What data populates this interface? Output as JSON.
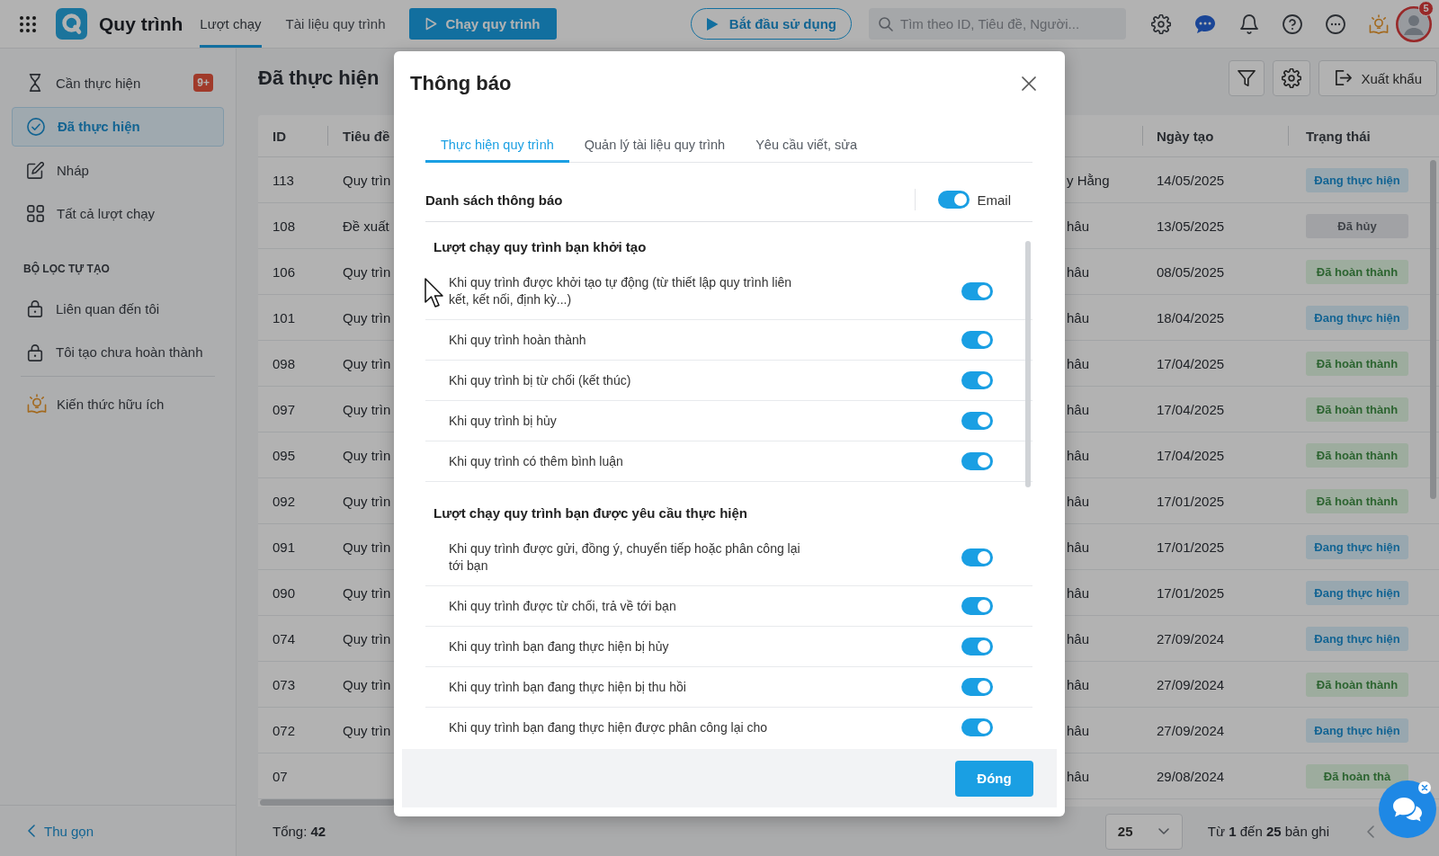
{
  "topbar": {
    "app_name": "Quy trình",
    "nav": [
      {
        "label": "Lượt chạy",
        "selected": true
      },
      {
        "label": "Tài liệu quy trình",
        "selected": false
      }
    ],
    "run_button": "Chạy quy trình",
    "start_button": "Bắt đầu sử dụng",
    "search": {
      "placeholder": "Tìm theo ID, Tiêu đề, Người..."
    },
    "avatar_badge": "5"
  },
  "sidebar": {
    "items": [
      {
        "label": "Cần thực hiện",
        "badge": "9+",
        "selected": false
      },
      {
        "label": "Đã thực hiện",
        "selected": true
      },
      {
        "label": "Nháp",
        "selected": false
      },
      {
        "label": "Tất cả lượt chạy",
        "selected": false
      }
    ],
    "filter_heading": "BỘ LỌC TỰ TẠO",
    "filters": [
      {
        "label": "Liên quan đến tôi",
        "selected": false
      },
      {
        "label": "Tôi tạo chưa hoàn thành",
        "selected": false
      }
    ],
    "links": [
      {
        "label": "Kiến thức hữu ích",
        "selected": false
      }
    ],
    "collapse_button": "Thu gọn"
  },
  "main": {
    "title": "Đã thực hiện",
    "export_button": "Xuất khẩu",
    "table": {
      "columns": {
        "id": "ID",
        "title": "Tiêu đề",
        "date": "Ngày tạo",
        "status": "Trạng thái"
      },
      "rows": [
        {
          "id": "113",
          "title": "Quy trìn",
          "column_3": "y Hằng",
          "date": "14/05/2025",
          "status": {
            "label": "Đang thực hiện",
            "kind": "in_progress"
          }
        },
        {
          "id": "108",
          "title": "Đề xuất",
          "column_3": "hâu",
          "date": "13/05/2025",
          "status": {
            "label": "Đã hủy",
            "kind": "cancelled"
          }
        },
        {
          "id": "106",
          "title": "Quy trìn",
          "column_3": "hâu",
          "date": "08/05/2025",
          "status": {
            "label": "Đã hoàn thành",
            "kind": "done"
          }
        },
        {
          "id": "101",
          "title": "Quy trìn",
          "column_3": "hâu",
          "date": "18/04/2025",
          "status": {
            "label": "Đang thực hiện",
            "kind": "in_progress"
          }
        },
        {
          "id": "098",
          "title": "Quy trìn",
          "column_3": "hâu",
          "date": "17/04/2025",
          "status": {
            "label": "Đã hoàn thành",
            "kind": "done"
          }
        },
        {
          "id": "097",
          "title": "Quy trìn",
          "column_3": "hâu",
          "date": "17/04/2025",
          "status": {
            "label": "Đã hoàn thành",
            "kind": "done"
          }
        },
        {
          "id": "095",
          "title": "Quy trìn",
          "column_3": "hâu",
          "date": "17/04/2025",
          "status": {
            "label": "Đã hoàn thành",
            "kind": "done"
          }
        },
        {
          "id": "092",
          "title": "Quy trìn",
          "column_3": "hâu",
          "date": "17/01/2025",
          "status": {
            "label": "Đã hoàn thành",
            "kind": "done"
          }
        },
        {
          "id": "091",
          "title": "Quy trìn",
          "column_3": "hâu",
          "date": "17/01/2025",
          "status": {
            "label": "Đang thực hiện",
            "kind": "in_progress"
          }
        },
        {
          "id": "090",
          "title": "Quy trìn",
          "column_3": "hâu",
          "date": "17/01/2025",
          "status": {
            "label": "Đang thực hiện",
            "kind": "in_progress"
          }
        },
        {
          "id": "074",
          "title": "Quy trìn",
          "column_3": "hâu",
          "date": "27/09/2024",
          "status": {
            "label": "Đang thực hiện",
            "kind": "in_progress"
          }
        },
        {
          "id": "073",
          "title": "Quy trìn",
          "column_3": "hâu",
          "date": "27/09/2024",
          "status": {
            "label": "Đã hoàn thành",
            "kind": "done"
          }
        },
        {
          "id": "072",
          "title": "Quy trìn",
          "column_3": "hâu",
          "date": "27/09/2024",
          "status": {
            "label": "Đang thực hiện",
            "kind": "in_progress"
          }
        },
        {
          "id": "07",
          "column_3": "hâu",
          "date": "29/08/2024",
          "status": {
            "label": "Đã hoàn thà",
            "kind": "done"
          }
        }
      ]
    },
    "footer": {
      "total": "Tổng: **42**",
      "page_size": "25",
      "range": "Từ **1** đến **25** bản ghi"
    }
  },
  "modal": {
    "title": "Thông báo",
    "tabs": [
      {
        "label": "Thực hiện quy trình",
        "selected": true
      },
      {
        "label": "Quản lý tài liệu quy trình",
        "selected": false
      },
      {
        "label": "Yêu cầu viết, sửa",
        "selected": false
      }
    ],
    "list_header": {
      "label": "Danh sách thông báo",
      "channel": {
        "label": "Email",
        "on": true
      }
    },
    "sections": [
      {
        "title": "Lượt chạy quy trình bạn khởi tạo",
        "items": [
          {
            "label": "Khi quy trình được khởi tạo tự động (từ thiết lập quy trình liên kết, kết nối, định kỳ...)",
            "on": true
          },
          {
            "label": "Khi quy trình hoàn thành",
            "on": true
          },
          {
            "label": "Khi quy trình bị từ chối (kết thúc)",
            "on": true
          },
          {
            "label": "Khi quy trình bị hủy",
            "on": true
          },
          {
            "label": "Khi quy trình có thêm bình luận",
            "on": true
          }
        ]
      },
      {
        "title": "Lượt chạy quy trình bạn được yêu cầu thực hiện",
        "items": [
          {
            "label": "Khi quy trình được gửi, đồng ý, chuyển tiếp hoặc phân công lại tới bạn",
            "on": true
          },
          {
            "label": "Khi quy trình được từ chối, trả về tới bạn",
            "on": true
          },
          {
            "label": "Khi quy trình bạn đang thực hiện bị hủy",
            "on": true
          },
          {
            "label": "Khi quy trình bạn đang thực hiện bị thu hồi",
            "on": true
          },
          {
            "label": "Khi quy trình bạn đang thực hiện được phân công lại cho",
            "on": true
          }
        ]
      }
    ],
    "close_button": "Đóng"
  }
}
